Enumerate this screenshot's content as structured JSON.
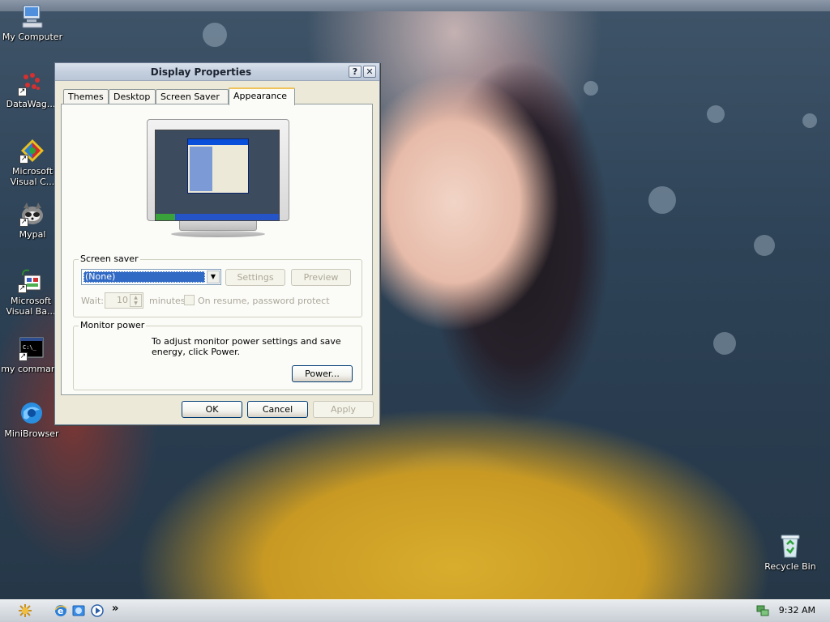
{
  "desktop": {
    "icons": [
      {
        "label": "My Computer",
        "icon": "my-computer-icon"
      },
      {
        "label": "DataWag...",
        "icon": "datawag-icon"
      },
      {
        "label": "Microsoft Visual C...",
        "icon": "visual-c-icon"
      },
      {
        "label": "Mypal",
        "icon": "mypal-icon"
      },
      {
        "label": "Microsoft Visual Ba...",
        "icon": "visual-basic-icon"
      },
      {
        "label": "my command",
        "icon": "command-prompt-icon"
      },
      {
        "label": "MiniBrowser",
        "icon": "minibrowser-icon"
      }
    ],
    "recycle_bin": "Recycle Bin"
  },
  "dialog": {
    "title": "Display Properties",
    "help_button": "?",
    "close_button": "✕",
    "tabs": [
      {
        "label": "Themes",
        "active": false
      },
      {
        "label": "Desktop",
        "active": false
      },
      {
        "label": "Screen Saver",
        "active": false
      },
      {
        "label": "Appearance",
        "active": true
      }
    ],
    "screen_saver": {
      "group_label": "Screen saver",
      "selected": "(None)",
      "settings_button": "Settings",
      "preview_button": "Preview",
      "wait_label": "Wait:",
      "wait_value": "10",
      "minutes_label": "minutes",
      "password_label": "On resume, password protect"
    },
    "monitor_power": {
      "group_label": "Monitor power",
      "description": "To adjust monitor power settings and save energy, click Power.",
      "power_button": "Power..."
    },
    "buttons": {
      "ok": "OK",
      "cancel": "Cancel",
      "apply": "Apply"
    }
  },
  "taskbar": {
    "quick_launch": [
      "start-icon",
      "internet-explorer-icon",
      "explorer-icon",
      "media-player-icon"
    ],
    "overflow": "»",
    "clock": "9:32 AM"
  },
  "colors": {
    "dialog_bg": "#ece9d8",
    "selection": "#316ac5",
    "active_tab_accent": "#f0c35a"
  }
}
